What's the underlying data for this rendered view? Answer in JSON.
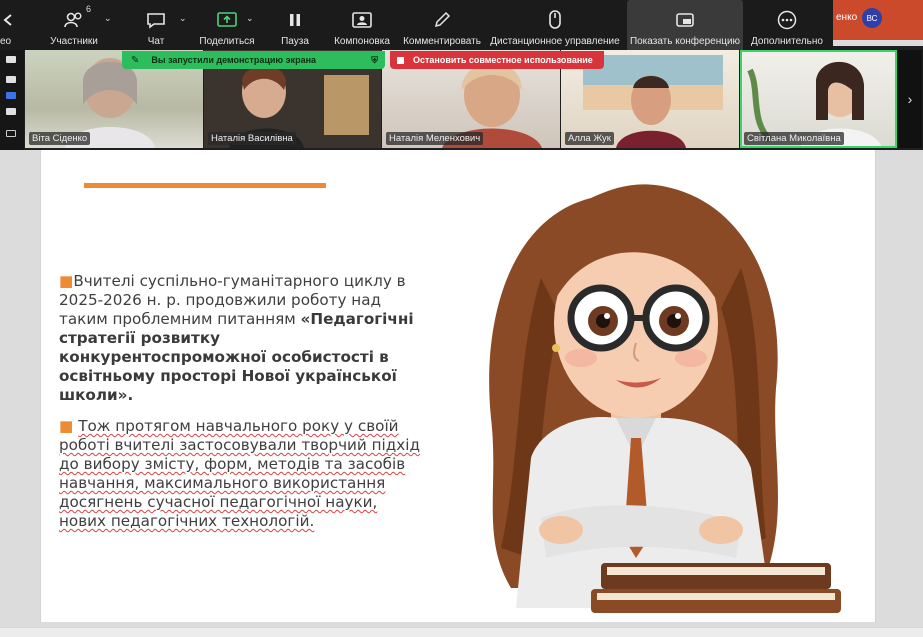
{
  "toolbar": {
    "left_cut_label": "ео",
    "buttons": [
      {
        "label": "Участники",
        "icon": "participants-icon",
        "count": "6"
      },
      {
        "label": "Чат",
        "icon": "chat-icon"
      },
      {
        "label": "Поделиться",
        "icon": "share-screen-icon"
      },
      {
        "label": "Пауза",
        "icon": "pause-icon"
      },
      {
        "label": "Компоновка",
        "icon": "layout-icon"
      },
      {
        "label": "Комментировать",
        "icon": "pencil-icon"
      },
      {
        "label": "Дистанционное управление",
        "icon": "mouse-icon"
      },
      {
        "label": "Показать конференцию",
        "icon": "show-meeting-icon"
      },
      {
        "label": "Дополнительно",
        "icon": "more-icon"
      }
    ]
  },
  "window_corner": {
    "name_cut": "енко",
    "avatar_initials": "ВС"
  },
  "share_banner": {
    "status": "Вы запустили демонстрацию экрана",
    "stop_label": "Остановить совместное использование"
  },
  "participants": [
    {
      "name": "Віта Сіденко"
    },
    {
      "name": "Наталія Василівна"
    },
    {
      "name": "Наталія Меленхович"
    },
    {
      "name": "Алла Жук"
    },
    {
      "name": "Світлана Миколаївна"
    }
  ],
  "slide": {
    "p1_plain": "Вчителі суспільно-гуманітарного циклу в 2025-2026 н. р. продовжили роботу над таким проблемним питанням ",
    "p1_bold": "«Педагогічні стратегії розвитку конкурентоспроможної особистості  в освітньому просторі Нової української школи».",
    "p2": "Тож протягом навчального року у своїй роботі вчителі застосовували творчий підхід до вибору змісту, форм, методів та засобів навчання, максимального використання досягнень сучасної педагогічної науки, нових педагогічних технологій."
  },
  "colors": {
    "accent_orange": "#ec8b33",
    "toolbar_bg": "#1b1b1b",
    "share_green": "#2dbd5c",
    "stop_red": "#d9343b"
  }
}
